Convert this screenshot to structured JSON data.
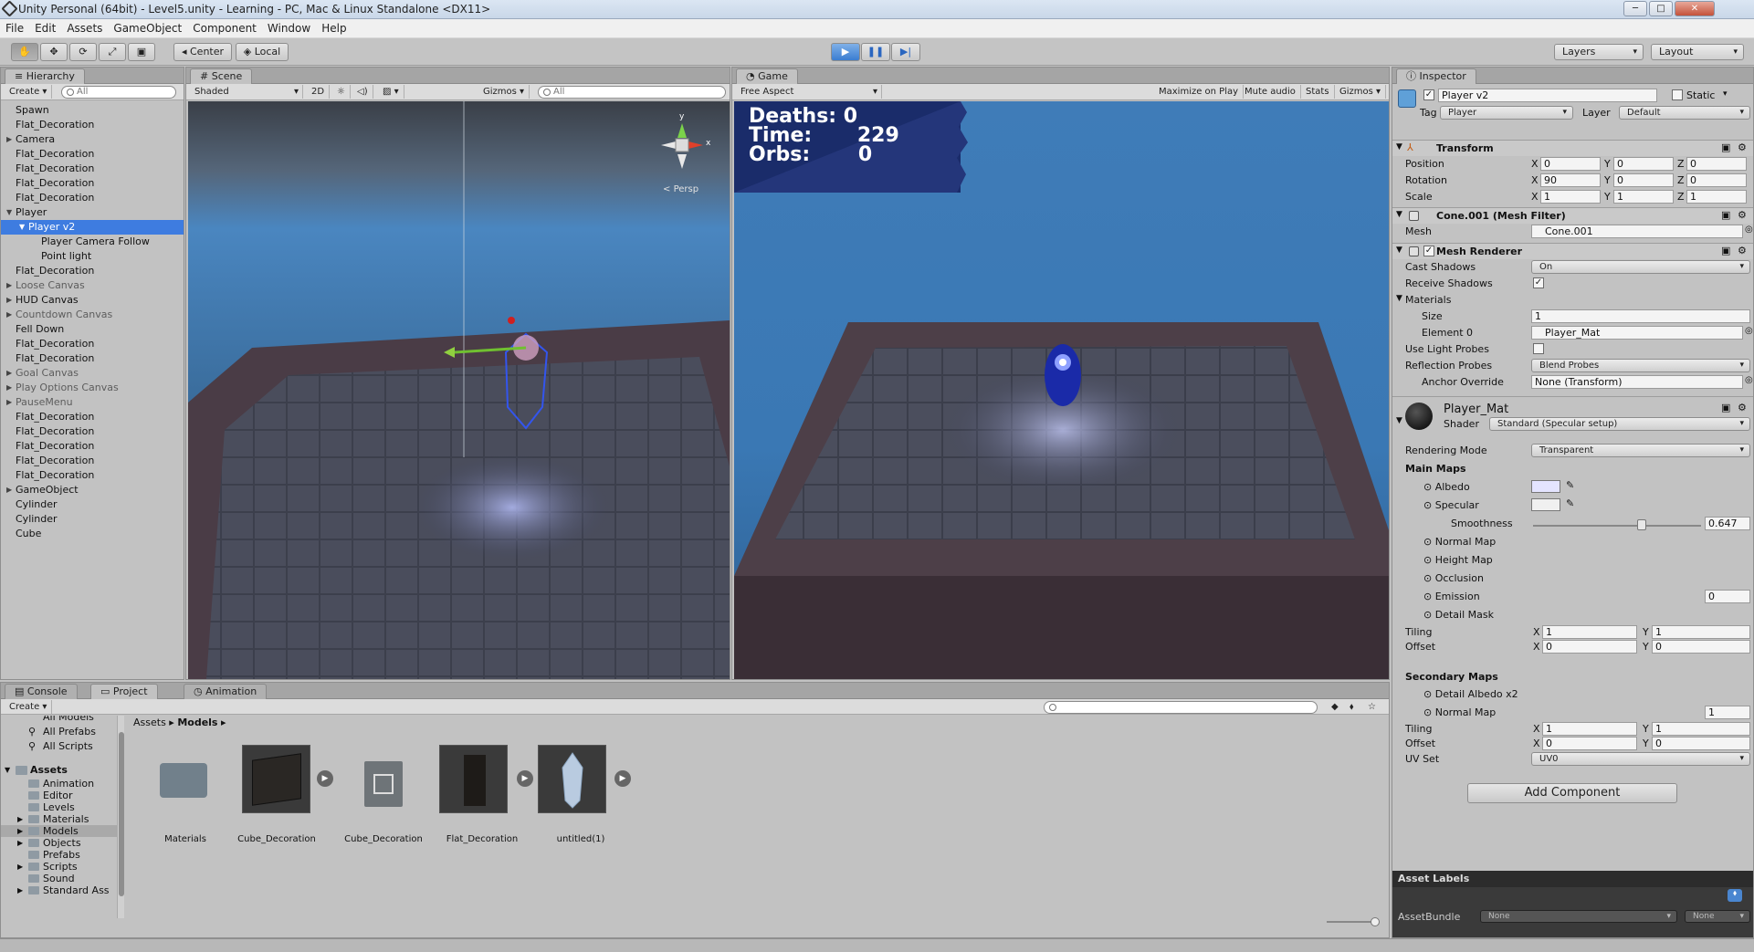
{
  "window": {
    "title": "Unity Personal (64bit) - Level5.unity - Learning - PC, Mac & Linux Standalone <DX11>"
  },
  "menu": [
    "File",
    "Edit",
    "Assets",
    "GameObject",
    "Component",
    "Window",
    "Help"
  ],
  "toolbar": {
    "pivot_label": "Center",
    "space_label": "Local",
    "layers_label": "Layers",
    "layout_label": "Layout"
  },
  "hierarchy": {
    "tab": "Hierarchy",
    "create_label": "Create",
    "search_placeholder": "All",
    "items": [
      {
        "label": "Spawn",
        "indent": 0,
        "arrow": false,
        "grey": false,
        "selected": false
      },
      {
        "label": "Flat_Decoration",
        "indent": 0,
        "arrow": false,
        "grey": false,
        "selected": false
      },
      {
        "label": "Camera",
        "indent": 0,
        "arrow": true,
        "open": false,
        "grey": false,
        "selected": false
      },
      {
        "label": "Flat_Decoration",
        "indent": 0,
        "arrow": false,
        "grey": false,
        "selected": false
      },
      {
        "label": "Flat_Decoration",
        "indent": 0,
        "arrow": false,
        "grey": false,
        "selected": false
      },
      {
        "label": "Flat_Decoration",
        "indent": 0,
        "arrow": false,
        "grey": false,
        "selected": false
      },
      {
        "label": "Flat_Decoration",
        "indent": 0,
        "arrow": false,
        "grey": false,
        "selected": false
      },
      {
        "label": "Player",
        "indent": 0,
        "arrow": true,
        "open": true,
        "grey": false,
        "selected": false
      },
      {
        "label": "Player v2",
        "indent": 1,
        "arrow": true,
        "open": true,
        "grey": false,
        "selected": true
      },
      {
        "label": "Player Camera Follow",
        "indent": 2,
        "arrow": false,
        "grey": false,
        "selected": false
      },
      {
        "label": "Point light",
        "indent": 2,
        "arrow": false,
        "grey": false,
        "selected": false
      },
      {
        "label": "Flat_Decoration",
        "indent": 0,
        "arrow": false,
        "grey": false,
        "selected": false
      },
      {
        "label": "Loose Canvas",
        "indent": 0,
        "arrow": true,
        "open": false,
        "grey": true,
        "selected": false
      },
      {
        "label": "HUD Canvas",
        "indent": 0,
        "arrow": true,
        "open": false,
        "grey": false,
        "selected": false
      },
      {
        "label": "Countdown Canvas",
        "indent": 0,
        "arrow": true,
        "open": false,
        "grey": true,
        "selected": false
      },
      {
        "label": "Fell Down",
        "indent": 0,
        "arrow": false,
        "grey": false,
        "selected": false
      },
      {
        "label": "Flat_Decoration",
        "indent": 0,
        "arrow": false,
        "grey": false,
        "selected": false
      },
      {
        "label": "Flat_Decoration",
        "indent": 0,
        "arrow": false,
        "grey": false,
        "selected": false
      },
      {
        "label": "Goal Canvas",
        "indent": 0,
        "arrow": true,
        "open": false,
        "grey": true,
        "selected": false
      },
      {
        "label": "Play Options Canvas",
        "indent": 0,
        "arrow": true,
        "open": false,
        "grey": true,
        "selected": false
      },
      {
        "label": "PauseMenu",
        "indent": 0,
        "arrow": true,
        "open": false,
        "grey": true,
        "selected": false
      },
      {
        "label": "Flat_Decoration",
        "indent": 0,
        "arrow": false,
        "grey": false,
        "selected": false
      },
      {
        "label": "Flat_Decoration",
        "indent": 0,
        "arrow": false,
        "grey": false,
        "selected": false
      },
      {
        "label": "Flat_Decoration",
        "indent": 0,
        "arrow": false,
        "grey": false,
        "selected": false
      },
      {
        "label": "Flat_Decoration",
        "indent": 0,
        "arrow": false,
        "grey": false,
        "selected": false
      },
      {
        "label": "Flat_Decoration",
        "indent": 0,
        "arrow": false,
        "grey": false,
        "selected": false
      },
      {
        "label": "GameObject",
        "indent": 0,
        "arrow": true,
        "open": false,
        "grey": false,
        "selected": false
      },
      {
        "label": "Cylinder",
        "indent": 0,
        "arrow": false,
        "grey": false,
        "selected": false
      },
      {
        "label": "Cylinder",
        "indent": 0,
        "arrow": false,
        "grey": false,
        "selected": false
      },
      {
        "label": "Cube",
        "indent": 0,
        "arrow": false,
        "grey": false,
        "selected": false
      }
    ]
  },
  "scene": {
    "tab": "Scene",
    "shading": "Shaded",
    "mode_2d": "2D",
    "gizmos": "Gizmos",
    "search_placeholder": "All",
    "persp_label": "Persp",
    "axis_y": "y",
    "axis_x": "x"
  },
  "game": {
    "tab": "Game",
    "aspect": "Free Aspect",
    "options": [
      "Maximize on Play",
      "Mute audio",
      "Stats",
      "Gizmos"
    ],
    "hud": {
      "deaths_label": "Deaths:",
      "deaths_value": "0",
      "time_label": "Time:",
      "time_value": "229",
      "orbs_label": "Orbs:",
      "orbs_value": "0"
    }
  },
  "inspector": {
    "tab": "Inspector",
    "object_name": "Player v2",
    "static_label": "Static",
    "tag_label": "Tag",
    "tag_value": "Player",
    "layer_label": "Layer",
    "layer_value": "Default",
    "transform": {
      "title": "Transform",
      "position_label": "Position",
      "position": [
        "0",
        "0",
        "0"
      ],
      "rotation_label": "Rotation",
      "rotation": [
        "90",
        "0",
        "0"
      ],
      "scale_label": "Scale",
      "scale": [
        "1",
        "1",
        "1"
      ]
    },
    "mesh_filter": {
      "title": "Cone.001 (Mesh Filter)",
      "mesh_label": "Mesh",
      "mesh_value": "Cone.001"
    },
    "mesh_renderer": {
      "title": "Mesh Renderer",
      "cast_shadows_label": "Cast Shadows",
      "cast_shadows_value": "On",
      "receive_shadows_label": "Receive Shadows",
      "materials_label": "Materials",
      "size_label": "Size",
      "size_value": "1",
      "element0_label": "Element 0",
      "element0_value": "Player_Mat",
      "light_probes_label": "Use Light Probes",
      "reflection_label": "Reflection Probes",
      "reflection_value": "Blend Probes",
      "anchor_label": "Anchor Override",
      "anchor_value": "None (Transform)"
    },
    "material": {
      "name": "Player_Mat",
      "shader_label": "Shader",
      "shader_value": "Standard (Specular setup)",
      "rendering_mode_label": "Rendering Mode",
      "rendering_mode_value": "Transparent",
      "main_maps_label": "Main Maps",
      "albedo_label": "Albedo",
      "specular_label": "Specular",
      "smoothness_label": "Smoothness",
      "smoothness_value": "0.647",
      "smoothness_fraction": 0.647,
      "normal_map_label": "Normal Map",
      "height_map_label": "Height Map",
      "occlusion_label": "Occlusion",
      "emission_label": "Emission",
      "emission_value": "0",
      "detail_mask_label": "Detail Mask",
      "tiling_label": "Tiling",
      "tiling": [
        "1",
        "1"
      ],
      "offset_label": "Offset",
      "offset": [
        "0",
        "0"
      ],
      "secondary_maps_label": "Secondary Maps",
      "detail_albedo_label": "Detail Albedo x2",
      "normal_map2_label": "Normal Map",
      "normal_map2_value": "1",
      "tiling2": [
        "1",
        "1"
      ],
      "offset2": [
        "0",
        "0"
      ],
      "uv_set_label": "UV Set",
      "uv_set_value": "UV0"
    },
    "add_component_label": "Add Component",
    "asset_labels": "Asset Labels",
    "asset_bundle_label": "AssetBundle",
    "asset_bundle_value": "None",
    "asset_bundle_variant": "None"
  },
  "bottom": {
    "tabs": [
      "Console",
      "Project",
      "Animation"
    ],
    "create_label": "Create",
    "favorites": [
      "All Models",
      "All Prefabs",
      "All Scripts"
    ],
    "assets_root": "Assets",
    "folders": [
      {
        "label": "Animation",
        "arrow": false,
        "selected": false
      },
      {
        "label": "Editor",
        "arrow": false,
        "selected": false
      },
      {
        "label": "Levels",
        "arrow": false,
        "selected": false
      },
      {
        "label": "Materials",
        "arrow": true,
        "selected": false
      },
      {
        "label": "Models",
        "arrow": true,
        "selected": true
      },
      {
        "label": "Objects",
        "arrow": true,
        "selected": false
      },
      {
        "label": "Prefabs",
        "arrow": false,
        "selected": false
      },
      {
        "label": "Scripts",
        "arrow": true,
        "selected": false
      },
      {
        "label": "Sound",
        "arrow": false,
        "selected": false
      },
      {
        "label": "Standard Ass",
        "arrow": true,
        "selected": false
      }
    ],
    "breadcrumb": [
      "Assets",
      "Models"
    ],
    "assets": [
      "Materials",
      "Cube_Decoration",
      "Cube_Decoration",
      "Flat_Decoration",
      "untitled(1)"
    ]
  },
  "colors": {
    "selection": "#3e7ce0",
    "play_accent": "#3b7dd1",
    "sky": "#3d78b3"
  }
}
